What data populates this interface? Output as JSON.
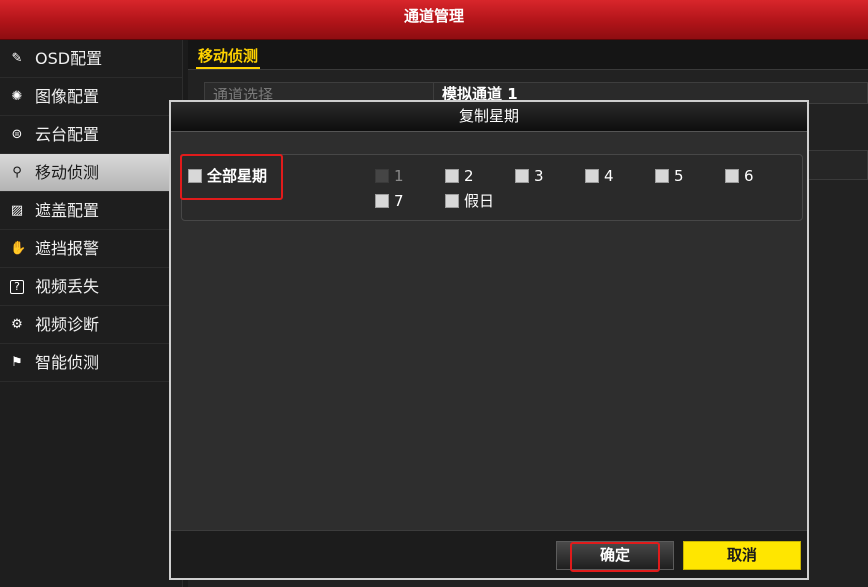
{
  "titlebar": {
    "title": "通道管理"
  },
  "sidebar": {
    "items": [
      {
        "label": "OSD配置",
        "icon": "osd-pen-icon",
        "glyph": "✎"
      },
      {
        "label": "图像配置",
        "icon": "image-aperture-icon",
        "glyph": "✺"
      },
      {
        "label": "云台配置",
        "icon": "ptz-camera-icon",
        "glyph": "⊜"
      },
      {
        "label": "移动侦测",
        "icon": "motion-running-icon",
        "glyph": "⚲"
      },
      {
        "label": "遮盖配置",
        "icon": "privacy-mask-icon",
        "glyph": "▨"
      },
      {
        "label": "遮挡报警",
        "icon": "tamper-hand-icon",
        "glyph": "✋"
      },
      {
        "label": "视频丢失",
        "icon": "video-loss-question-icon",
        "glyph": "?"
      },
      {
        "label": "视频诊断",
        "icon": "video-diagnosis-icon",
        "glyph": "⚙"
      },
      {
        "label": "智能侦测",
        "icon": "smart-detect-icon",
        "glyph": "⚑"
      }
    ],
    "active_index": 3
  },
  "main": {
    "tab": "移动侦测",
    "channel_label": "通道选择",
    "channel_value": "模拟通道 1"
  },
  "dialog": {
    "title": "复制星期",
    "all_days_label": "全部星期",
    "days": [
      {
        "label": "1",
        "enabled": false,
        "checked": false
      },
      {
        "label": "2",
        "enabled": true,
        "checked": false
      },
      {
        "label": "3",
        "enabled": true,
        "checked": false
      },
      {
        "label": "4",
        "enabled": true,
        "checked": false
      },
      {
        "label": "5",
        "enabled": true,
        "checked": false
      },
      {
        "label": "6",
        "enabled": true,
        "checked": false
      },
      {
        "label": "7",
        "enabled": true,
        "checked": false
      },
      {
        "label": "假日",
        "enabled": true,
        "checked": false
      }
    ],
    "ok_label": "确定",
    "cancel_label": "取消"
  },
  "colors": {
    "titlebar_red": "#b11419",
    "tab_active_yellow": "#ffd200",
    "cancel_button_yellow": "#ffe600",
    "highlight_red": "#e01b1b"
  }
}
